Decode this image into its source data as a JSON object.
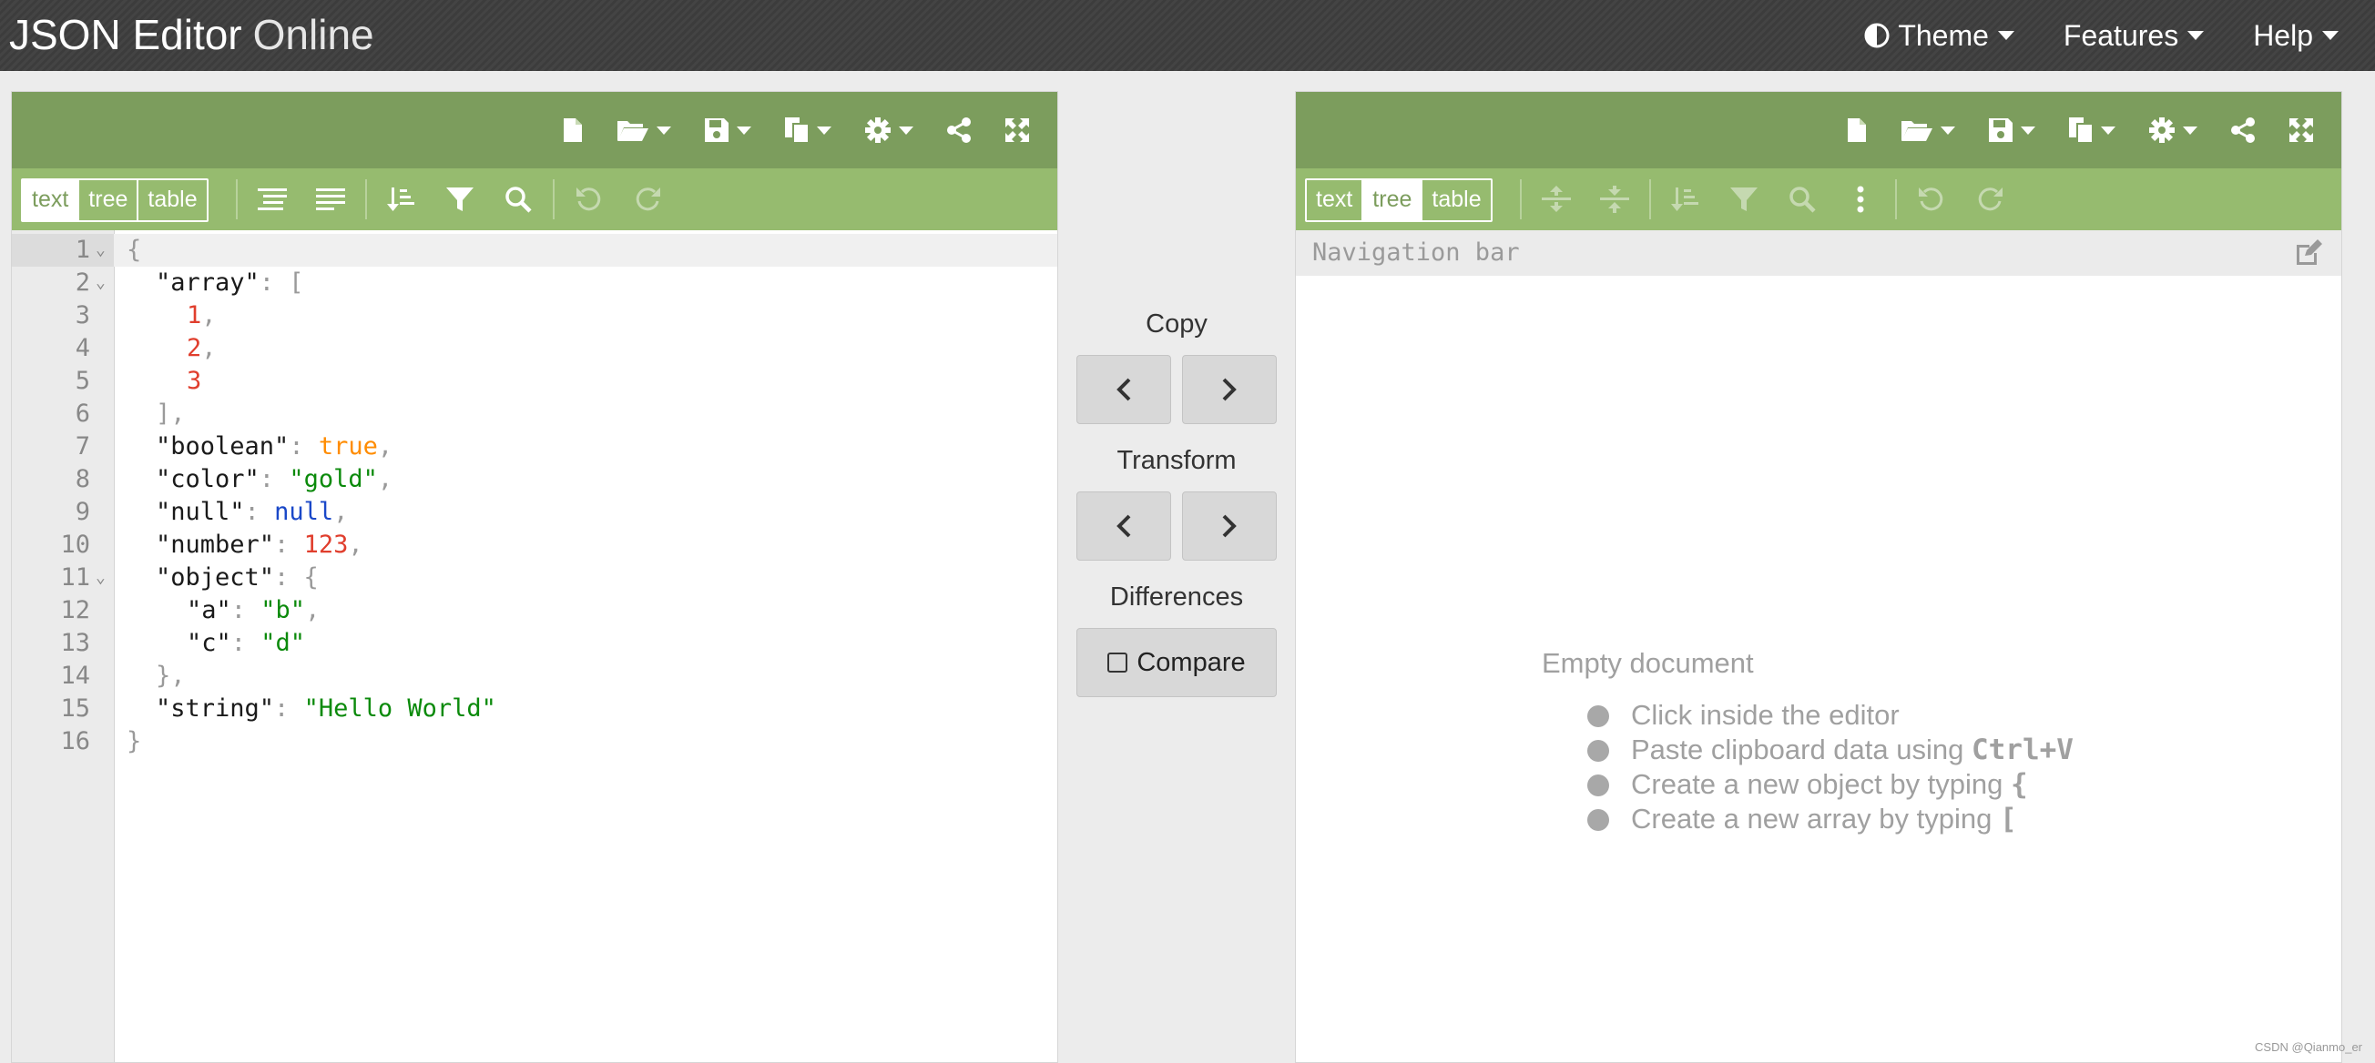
{
  "app": {
    "title_main": "JSON Editor",
    "title_light": "Online",
    "menus": [
      {
        "label": "Theme"
      },
      {
        "label": "Features"
      },
      {
        "label": "Help"
      }
    ]
  },
  "left_panel": {
    "modes": [
      "text",
      "tree",
      "table"
    ],
    "active_mode": "text",
    "lines": [
      {
        "num": "1",
        "fold": "⌄"
      },
      {
        "num": "2",
        "fold": "⌄"
      },
      {
        "num": "3"
      },
      {
        "num": "4"
      },
      {
        "num": "5"
      },
      {
        "num": "6"
      },
      {
        "num": "7"
      },
      {
        "num": "8"
      },
      {
        "num": "9"
      },
      {
        "num": "10"
      },
      {
        "num": "11",
        "fold": "⌄"
      },
      {
        "num": "12"
      },
      {
        "num": "13"
      },
      {
        "num": "14"
      },
      {
        "num": "15"
      },
      {
        "num": "16"
      }
    ],
    "code": {
      "l1": "{",
      "array_key": "\"array\"",
      "array_open": ": [",
      "n1": "1",
      "n2": "2",
      "n3": "3",
      "comma": ",",
      "array_close": "],",
      "boolean_key": "\"boolean\"",
      "boolean_val": "true",
      "color_key": "\"color\"",
      "color_val": "\"gold\"",
      "null_key": "\"null\"",
      "null_val": "null",
      "number_key": "\"number\"",
      "number_val": "123",
      "object_key": "\"object\"",
      "object_open": ": {",
      "a_key": "\"a\"",
      "a_val": "\"b\"",
      "c_key": "\"c\"",
      "c_val": "\"d\"",
      "object_close": "},",
      "string_key": "\"string\"",
      "string_val": "\"Hello World\"",
      "l16": "}",
      "colon": ": "
    }
  },
  "middle": {
    "copy_label": "Copy",
    "transform_label": "Transform",
    "differences_label": "Differences",
    "compare_label": "Compare"
  },
  "right_panel": {
    "modes": [
      "text",
      "tree",
      "table"
    ],
    "active_mode": "tree",
    "navbar_placeholder": "Navigation bar",
    "empty_title": "Empty document",
    "empty_items": [
      {
        "text": "Click inside the editor",
        "key": ""
      },
      {
        "text": "Paste clipboard data using ",
        "key": "Ctrl+V"
      },
      {
        "text": "Create a new object by typing ",
        "key": "{"
      },
      {
        "text": "Create a new array by typing ",
        "key": "["
      }
    ]
  },
  "watermark": "CSDN @Qianmo_er",
  "colors": {
    "menubar": "#7c9d5d",
    "toolbar": "#96bb6f",
    "header": "#3c3c3c"
  }
}
